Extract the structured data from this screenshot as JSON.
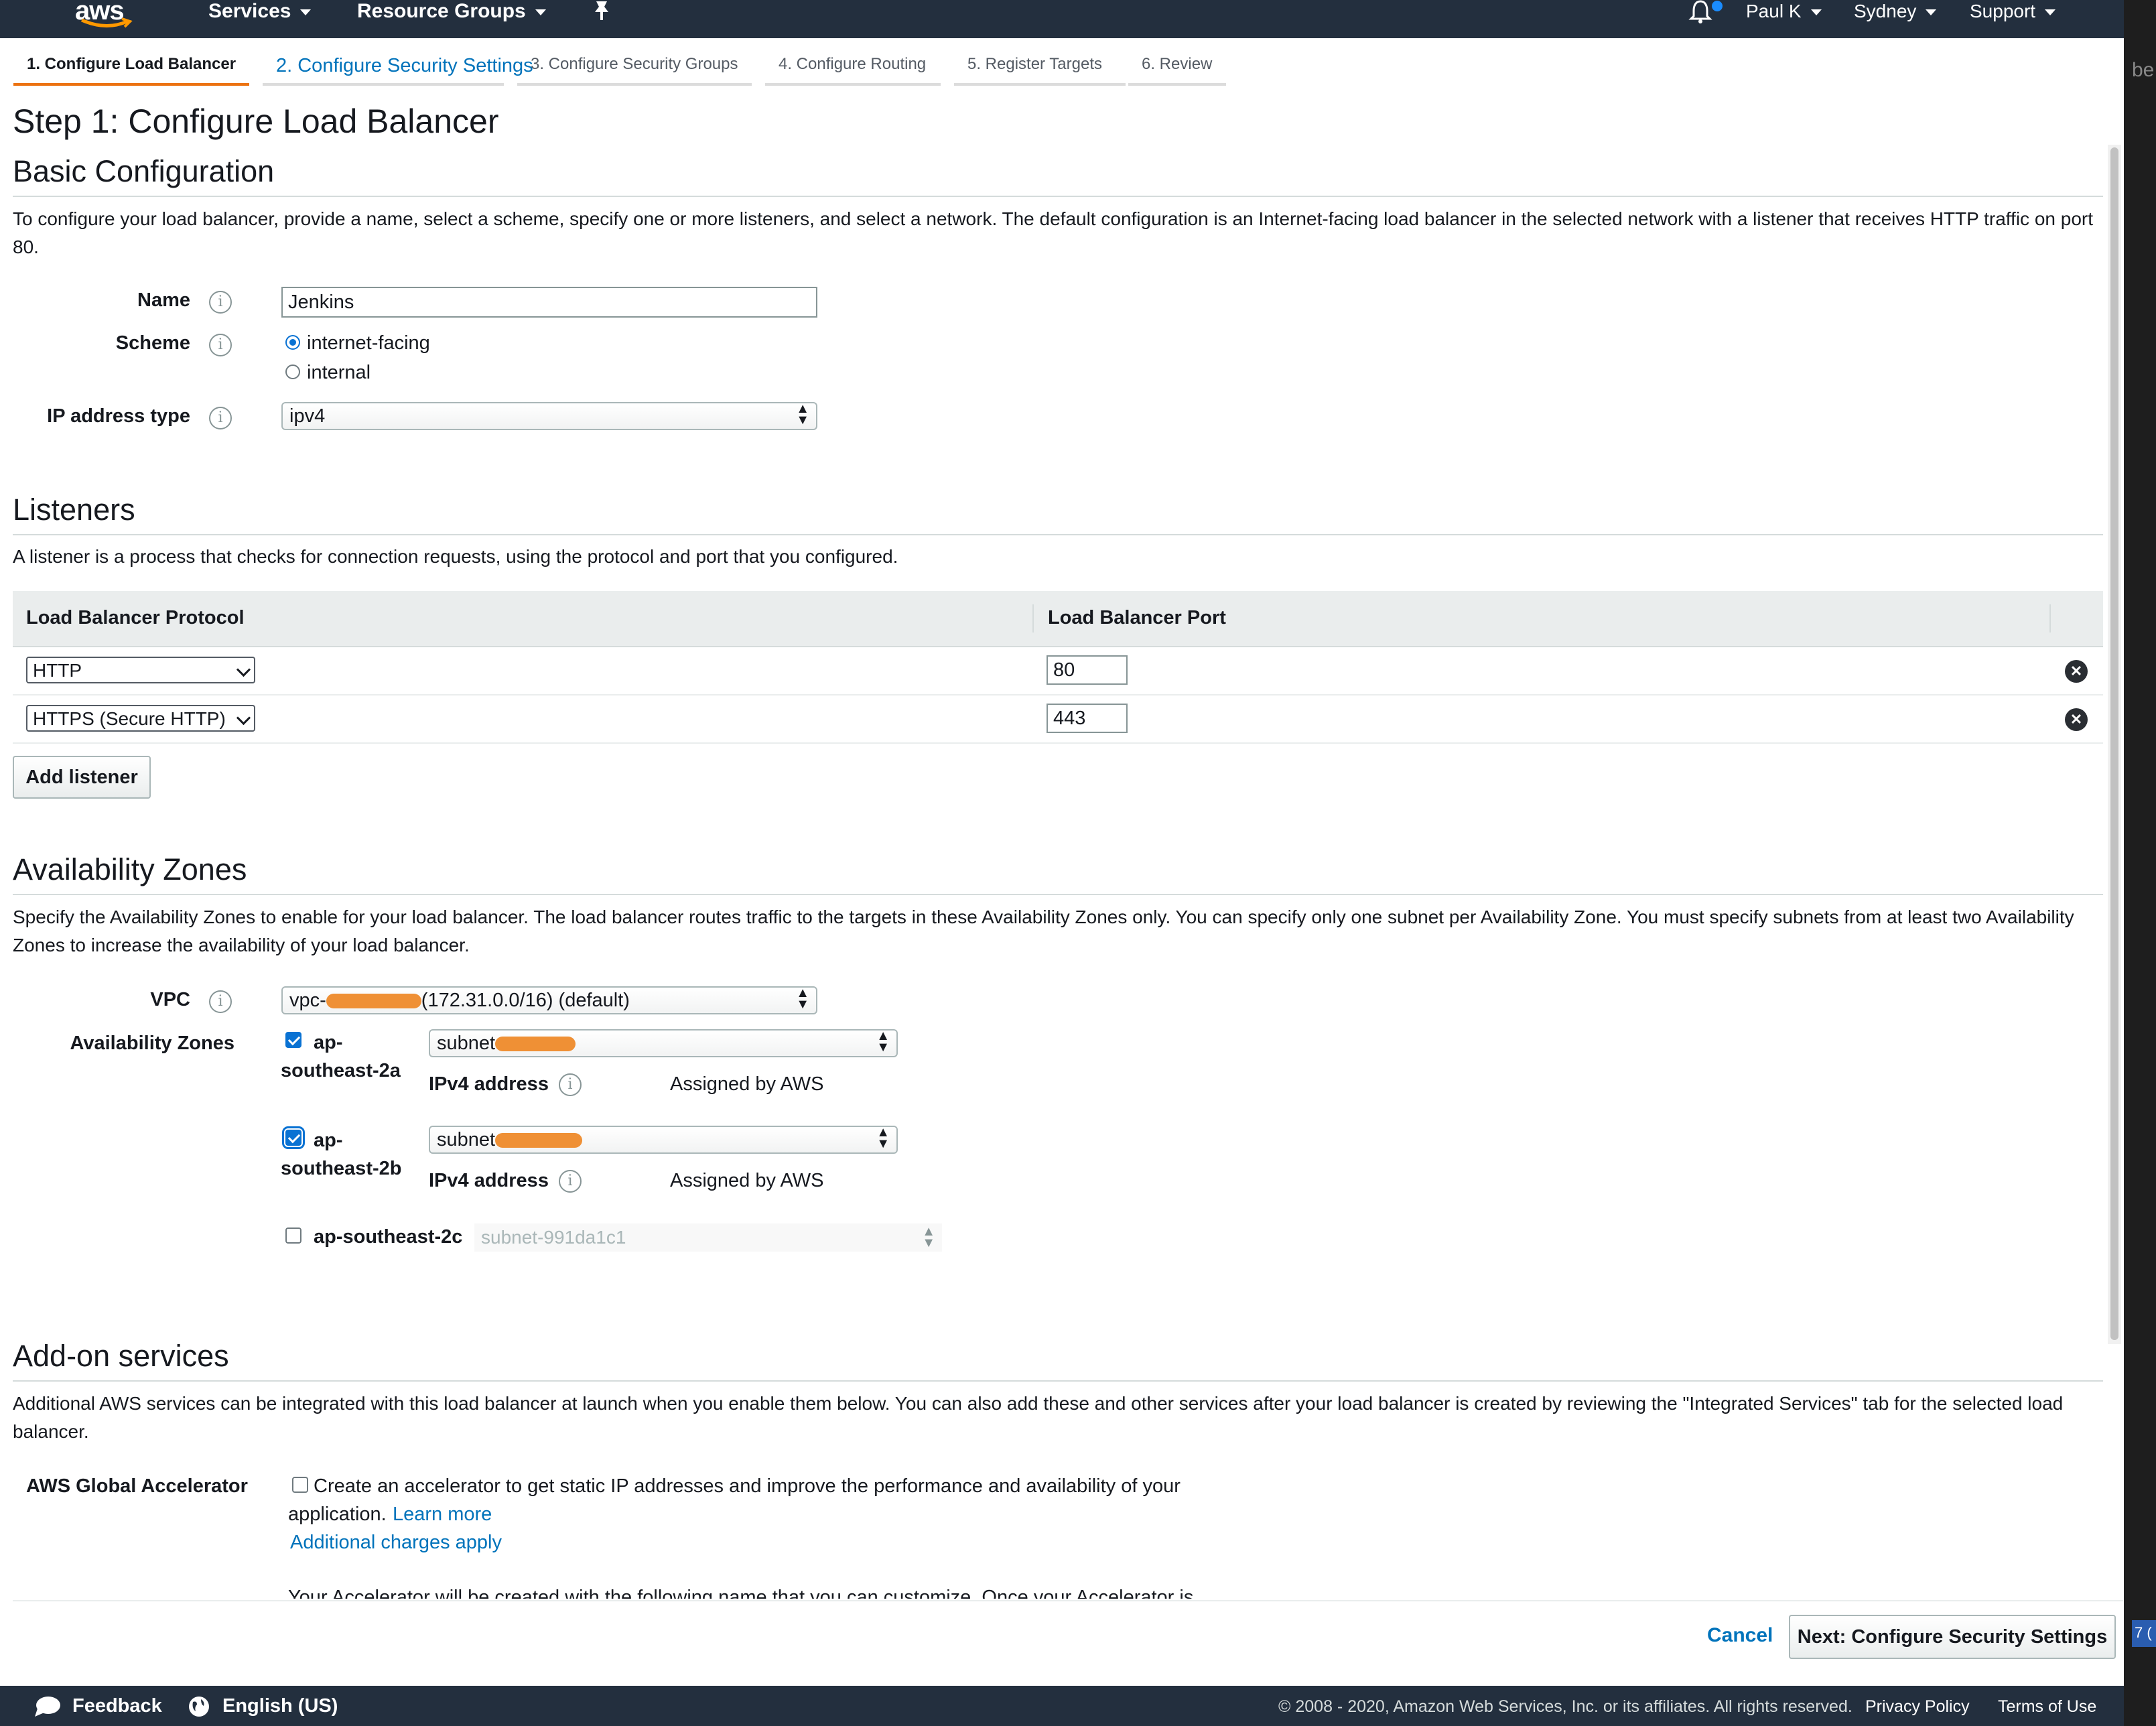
{
  "nav": {
    "logo": "aws",
    "services": "Services",
    "resource_groups": "Resource Groups",
    "user": "Paul K",
    "region": "Sydney",
    "support": "Support"
  },
  "wizard_tabs": [
    {
      "label": "1. Configure Load Balancer"
    },
    {
      "label": "2. Configure Security Settings"
    },
    {
      "label": "3. Configure Security Groups"
    },
    {
      "label": "4. Configure Routing"
    },
    {
      "label": "5. Register Targets"
    },
    {
      "label": "6. Review"
    }
  ],
  "page": {
    "title": "Step 1: Configure Load Balancer"
  },
  "basic": {
    "heading": "Basic Configuration",
    "description": "To configure your load balancer, provide a name, select a scheme, specify one or more listeners, and select a network. The default configuration is an Internet-facing load balancer in the selected network with a listener that receives HTTP traffic on port 80.",
    "name_label": "Name",
    "name_value": "Jenkins",
    "scheme_label": "Scheme",
    "scheme_options": [
      "internet-facing",
      "internal"
    ],
    "ip_type_label": "IP address type",
    "ip_type_value": "ipv4"
  },
  "listeners": {
    "heading": "Listeners",
    "description": "A listener is a process that checks for connection requests, using the protocol and port that you configured.",
    "col_protocol": "Load Balancer Protocol",
    "col_port": "Load Balancer Port",
    "rows": [
      {
        "protocol": "HTTP",
        "port": "80"
      },
      {
        "protocol": "HTTPS (Secure HTTP)",
        "port": "443"
      }
    ],
    "add_button": "Add listener"
  },
  "az": {
    "heading": "Availability Zones",
    "description": "Specify the Availability Zones to enable for your load balancer. The load balancer routes traffic to the targets in these Availability Zones only. You can specify only one subnet per Availability Zone. You must specify subnets from at least two Availability Zones to increase the availability of your load balancer.",
    "vpc_label": "VPC",
    "vpc_prefix": "vpc-",
    "vpc_suffix": "(172.31.0.0/16) (default)",
    "zones_label": "Availability Zones",
    "zones": [
      {
        "name_line1": "ap-",
        "name_line2": "southeast-2a",
        "subnet": "subnet",
        "checked": true,
        "ipv4_label": "IPv4 address",
        "ipv4_value": "Assigned by AWS"
      },
      {
        "name_line1": "ap-",
        "name_line2": "southeast-2b",
        "subnet": "subnet",
        "checked": true,
        "ipv4_label": "IPv4 address",
        "ipv4_value": "Assigned by AWS"
      },
      {
        "name": "ap-southeast-2c",
        "subnet": "subnet-991da1c1",
        "checked": false
      }
    ]
  },
  "addon": {
    "heading": "Add-on services",
    "description": "Additional AWS services can be integrated with this load balancer at launch when you enable them below. You can also add these and other services after your load balancer is created by reviewing the \"Integrated Services\" tab for the selected load balancer.",
    "accel_label": "AWS Global Accelerator",
    "accel_text_1": "Create an accelerator to get static IP addresses and improve the performance and availability of your",
    "accel_text_2": "application.",
    "learn_more": "Learn more",
    "charges": "Additional charges apply",
    "cut_text": "Your Accelerator will be created with the following name that you can customize. Once your Accelerator is"
  },
  "actions": {
    "cancel": "Cancel",
    "next": "Next: Configure Security Settings"
  },
  "footer": {
    "feedback": "Feedback",
    "language": "English (US)",
    "copyright": "© 2008 - 2020, Amazon Web Services, Inc. or its affiliates. All rights reserved.",
    "privacy": "Privacy Policy",
    "terms": "Terms of Use"
  },
  "edge": {
    "top_fragment": "be",
    "tab_fragment": "7 ("
  },
  "colors": {
    "nav_bg": "#232f3e",
    "accent_orange": "#ec7211",
    "link_blue": "#0073bb"
  }
}
